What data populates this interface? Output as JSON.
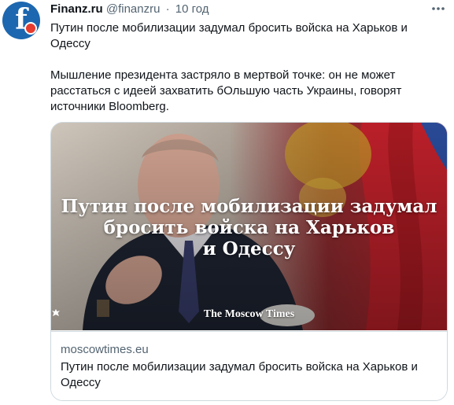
{
  "author": {
    "name": "Finanz.ru",
    "handle": "@finanzru",
    "separator": "·",
    "time": "10 год",
    "avatar_letter": "f"
  },
  "more_icon": "more-horizontal-icon",
  "tweet": {
    "line1": "Путин после мобилизации задумал бросить войска на Харьков и Одессу",
    "line2": "Мышление президента застряло в мертвой точке: он не может расстаться с идеей захватить бОльшую часть Украины, говорят источники Bloomberg."
  },
  "card": {
    "headline_lines": [
      "Путин после мобилизации задумал",
      "бросить войска на Харьков",
      "и Одессу"
    ],
    "brand_pre": "The",
    "brand_post": "Moscow Times",
    "domain": "moscowtimes.eu",
    "title": "Путин после мобилизации задумал бросить войска на Харьков и Одессу"
  },
  "colors": {
    "avatar": "#1d67b0",
    "avatar_dot": "#e63b2e",
    "flag_red": "#c4212b",
    "muted_text": "#536471"
  }
}
